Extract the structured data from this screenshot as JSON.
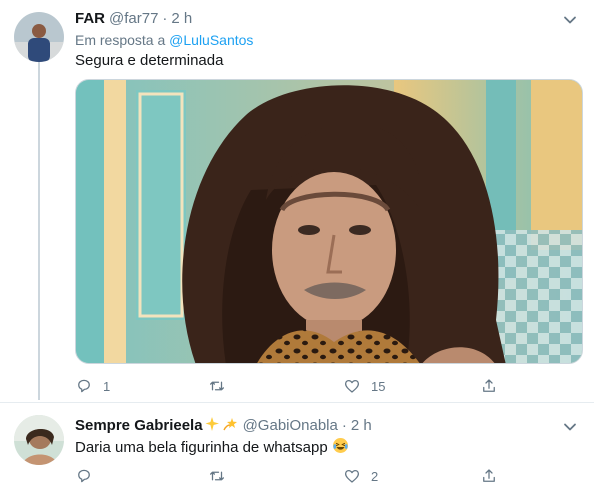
{
  "tweets": [
    {
      "name": "FAR",
      "handle": "@far77",
      "separator": "·",
      "time": "2 h",
      "reply_prefix": "Em resposta a",
      "reply_mention": "@LuluSantos",
      "text": "Segura e determinada",
      "actions": {
        "reply_count": "1",
        "retweet_count": "",
        "like_count": "15"
      }
    },
    {
      "name": "Sempre Gabrieela",
      "name_emojis": [
        "sparkles-emoji",
        "dizzy-emoji"
      ],
      "handle": "@GabiOnabla",
      "separator": "·",
      "time": "2 h",
      "text": "Daria uma bela figurinha de whatsapp",
      "text_emoji": "laughing-tears-emoji",
      "actions": {
        "reply_count": "",
        "retweet_count": "",
        "like_count": "2"
      }
    }
  ],
  "colors": {
    "text_primary": "#14171a",
    "text_secondary": "#657786",
    "accent": "#1da1f2",
    "divider": "#e6ecf0"
  }
}
